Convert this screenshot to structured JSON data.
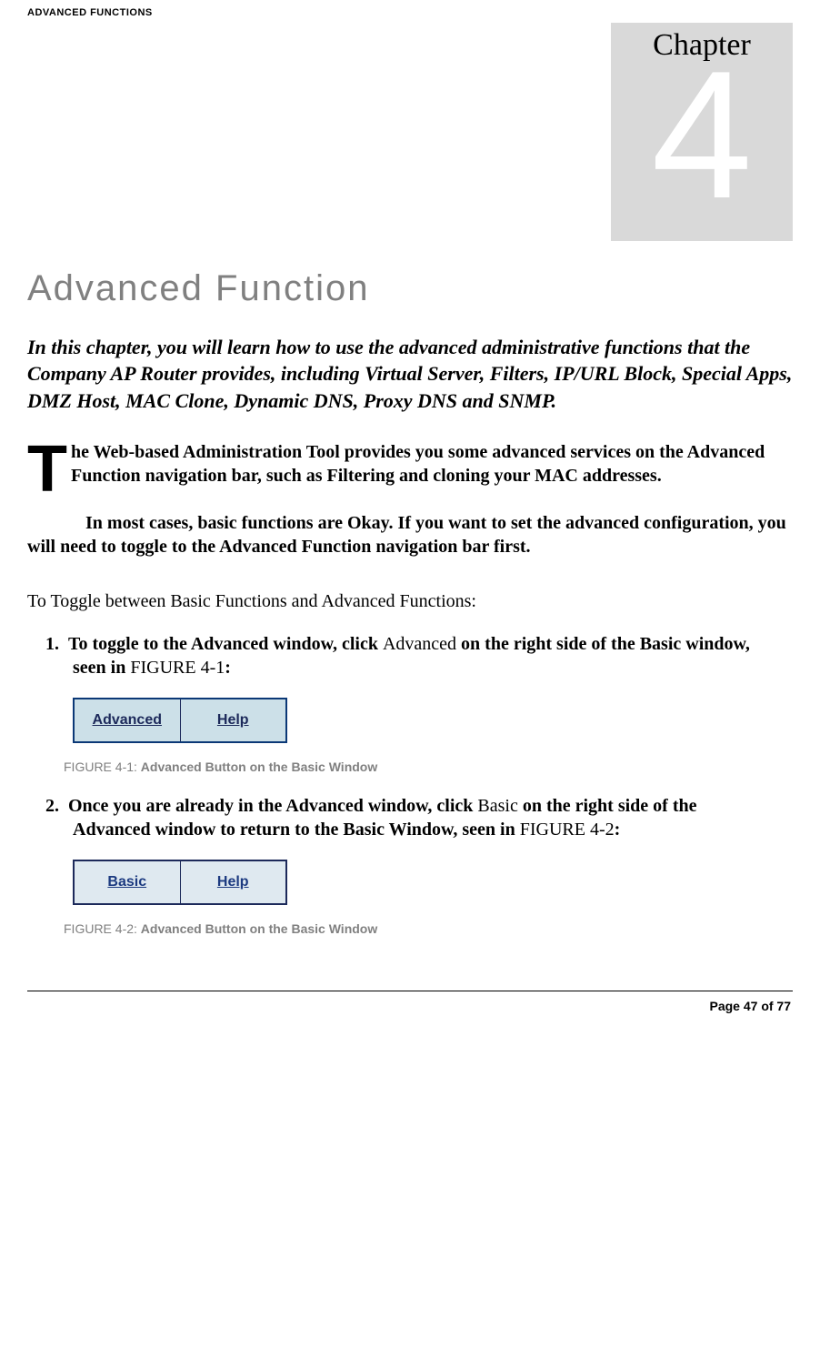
{
  "header": {
    "section": "ADVANCED FUNCTIONS"
  },
  "chapter": {
    "label": "Chapter",
    "number": "4"
  },
  "title": "Advanced Function",
  "intro": "In this chapter, you will learn how to use the advanced administrative functions that the Company AP Router provides, including Virtual Server, Filters, IP/URL Block, Special Apps, DMZ Host, MAC Clone, Dynamic DNS, Proxy DNS and SNMP.",
  "dropcap": "T",
  "p1": "he Web-based Administration Tool provides you some advanced services on the Advanced Function navigation bar, such as Filtering and cloning your MAC addresses.",
  "p2": "In most cases, basic functions are Okay. If you want to set the advanced configuration, you will need to toggle to the Advanced Function navigation bar first.",
  "toggle_intro": "To Toggle between Basic Functions and Advanced Functions:",
  "steps": {
    "s1": {
      "num": "1.",
      "pre": "To toggle to the Advanced window, click ",
      "mid": "Advanced",
      "post_a": " on the right side of the Basic window, seen in ",
      "figref": "FIGURE 4-1",
      "post_b": ":"
    },
    "s2": {
      "num": "2.",
      "pre": "Once you are already in the Advanced window, click ",
      "mid": "Basic",
      "post_a": " on the right side of the Advanced window to return to the Basic Window, seen in ",
      "figref": "FIGURE 4-2",
      "post_b": ":"
    }
  },
  "figures": {
    "f1": {
      "left": "Advanced",
      "right": "Help",
      "caption_label": "FIGURE 4-1: ",
      "caption_text": "Advanced Button on the Basic Window"
    },
    "f2": {
      "left": "Basic",
      "right": "Help",
      "caption_label": "FIGURE 4-2: ",
      "caption_text": "Advanced Button on the Basic Window"
    }
  },
  "footer": {
    "page": "Page 47 of 77"
  }
}
